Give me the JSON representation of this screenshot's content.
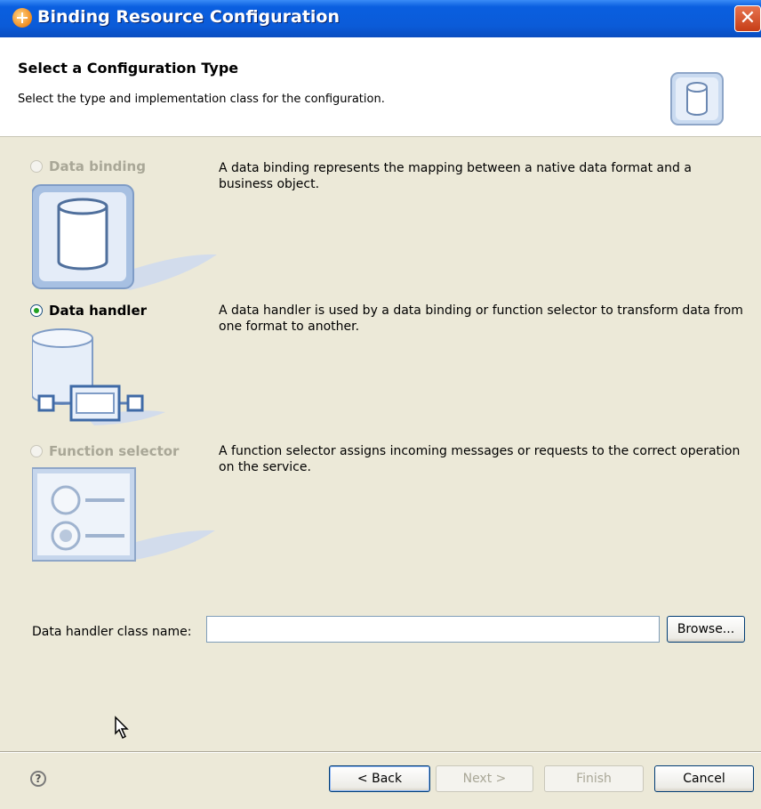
{
  "window": {
    "title": "Binding Resource Configuration"
  },
  "banner": {
    "title": "Select a Configuration Type",
    "description": "Select the type and implementation class for the configuration."
  },
  "options": [
    {
      "label": "Data binding",
      "description": "A data binding represents the mapping between a native data format and a business object.",
      "selected": false,
      "enabled": false,
      "icon": "data-binding-icon"
    },
    {
      "label": "Data handler",
      "description": "A data handler is used by a data binding or function selector to transform data from one format to another.",
      "selected": true,
      "enabled": true,
      "icon": "data-handler-icon"
    },
    {
      "label": "Function selector",
      "description": "A function selector assigns incoming messages or requests to the correct operation on the service.",
      "selected": false,
      "enabled": false,
      "icon": "function-selector-icon"
    }
  ],
  "class_field": {
    "label": "Data handler class name:",
    "value": "",
    "browse_label": "Browse..."
  },
  "footer": {
    "help_label": "?",
    "back_label": "< Back",
    "next_label": "Next >",
    "finish_label": "Finish",
    "cancel_label": "Cancel"
  }
}
